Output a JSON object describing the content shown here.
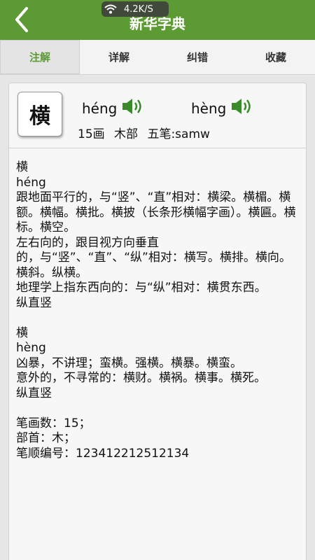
{
  "header": {
    "title": "新华字典",
    "status_speed": "4.2K/S"
  },
  "tabs": [
    {
      "label": "注解",
      "active": true
    },
    {
      "label": "详解",
      "active": false
    },
    {
      "label": "纠错",
      "active": false
    },
    {
      "label": "收藏",
      "active": false
    }
  ],
  "entry": {
    "character": "横",
    "pinyin": [
      "héng",
      "hèng"
    ],
    "strokes": "15画",
    "radical": "木部",
    "wubi": "五笔:samw"
  },
  "definitions": {
    "sense1": {
      "char": "横",
      "pinyin": "héng",
      "lines": [
        "跟地面平行的，与“竖”、“直”相对：横梁。横楣。横额。横幅。横批。横披（长条形横幅字画）。横匾。横标。横空。",
        "左右向的，跟目视方向垂直",
        "的，与“竖”、“直”、“纵”相对：横写。横排。横向。横斜。纵横。",
        "地理学上指东西向的：与“纵”相对：横贯东西。",
        "纵直竖"
      ]
    },
    "sense2": {
      "char": "横",
      "pinyin": "hèng",
      "lines": [
        "凶暴，不讲理；蛮横。强横。横暴。横蛮。",
        "意外的，不寻常的：横财。横祸。横事。横死。",
        "纵直竖"
      ]
    },
    "info": [
      "笔画数：15；",
      "部首：木；",
      "笔顺编号：123412212512134"
    ]
  },
  "colors": {
    "header": "#5c9a33",
    "active_tab": "#5c9a33",
    "speaker": "#3a8a2a"
  }
}
